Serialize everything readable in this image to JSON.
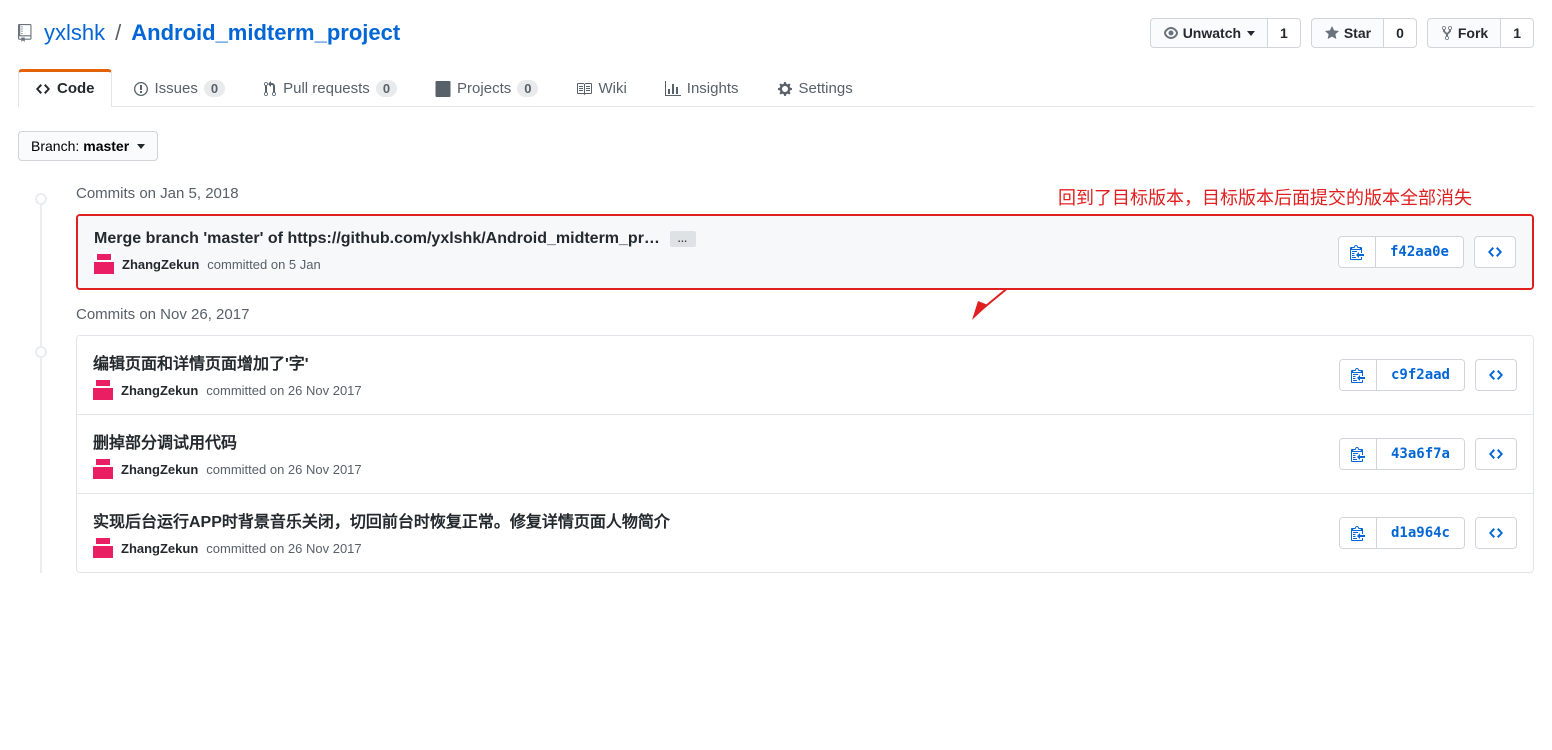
{
  "repo": {
    "owner": "yxlshk",
    "name": "Android_midterm_project"
  },
  "actions": {
    "unwatch": {
      "label": "Unwatch",
      "count": "1"
    },
    "star": {
      "label": "Star",
      "count": "0"
    },
    "fork": {
      "label": "Fork",
      "count": "1"
    }
  },
  "tabs": {
    "code": "Code",
    "issues": {
      "label": "Issues",
      "count": "0"
    },
    "pulls": {
      "label": "Pull requests",
      "count": "0"
    },
    "projects": {
      "label": "Projects",
      "count": "0"
    },
    "wiki": "Wiki",
    "insights": "Insights",
    "settings": "Settings"
  },
  "branch": {
    "label": "Branch:",
    "current": "master"
  },
  "annotation": "回到了目标版本，目标版本后面提交的版本全部消失",
  "groups": [
    {
      "heading": "Commits on Jan 5, 2018",
      "highlight": true,
      "commits": [
        {
          "title": "Merge branch 'master' of https://github.com/yxlshk/Android_midterm_pr…",
          "author": "ZhangZekun",
          "date": "on 5 Jan",
          "hash": "f42aa0e",
          "more": true
        }
      ]
    },
    {
      "heading": "Commits on Nov 26, 2017",
      "highlight": false,
      "commits": [
        {
          "title": "编辑页面和详情页面增加了'字'",
          "author": "ZhangZekun",
          "date": "on 26 Nov 2017",
          "hash": "c9f2aad"
        },
        {
          "title": "删掉部分调试用代码",
          "author": "ZhangZekun",
          "date": "on 26 Nov 2017",
          "hash": "43a6f7a"
        },
        {
          "title": "实现后台运行APP时背景音乐关闭，切回前台时恢复正常。修复详情页面人物简介",
          "author": "ZhangZekun",
          "date": "on 26 Nov 2017",
          "hash": "d1a964c"
        }
      ]
    }
  ],
  "meta": {
    "committed": "committed",
    "more": "…"
  }
}
